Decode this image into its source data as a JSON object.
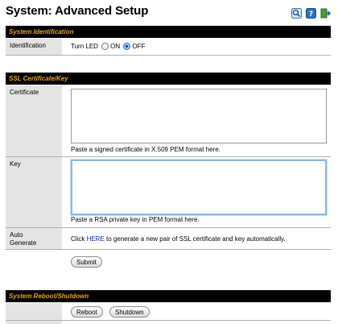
{
  "page": {
    "title": "System: Advanced Setup"
  },
  "toolbar": {
    "icons": [
      "search-icon",
      "help-icon",
      "exit-icon"
    ]
  },
  "identification": {
    "section_title": "System Identification",
    "row_label": "Identification",
    "led_label": "Turn LED",
    "on_label": "ON",
    "off_label": "OFF",
    "selected": "OFF"
  },
  "ssl": {
    "section_title": "SSL Certificate/Key",
    "certificate_label": "Certificate",
    "certificate_value": "",
    "certificate_hint": "Paste a signed certificate in X.509 PEM format here.",
    "key_label": "Key",
    "key_value": "",
    "key_hint": "Paste a RSA private key in PEM format here.",
    "auto_label": "Auto Generate",
    "auto_prefix": "Click ",
    "auto_link": "HERE",
    "auto_suffix": " to generate a new pair of SSL certificate and key automatically.",
    "submit_label": "Submit"
  },
  "reboot": {
    "section_title": "System Reboot/Shutdown",
    "reboot_label": "Reboot",
    "shutdown_label": "Shutdown"
  },
  "colors": {
    "section_bar": "#000000",
    "section_text": "#e6a51e",
    "label_bg": "#e4e4e4",
    "link": "#0a2ea0"
  }
}
